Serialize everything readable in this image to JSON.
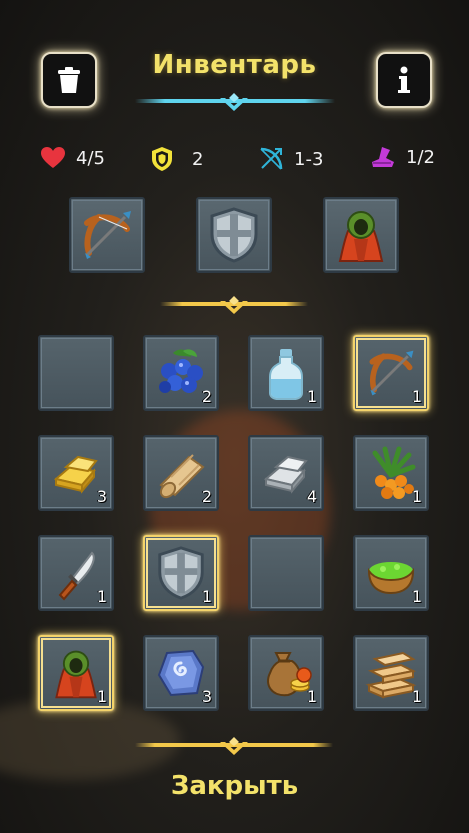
{
  "header": {
    "title": "Инвентарь",
    "trash_icon": "trash-icon",
    "info_icon": "info-icon"
  },
  "stats": [
    {
      "icon": "heart-icon",
      "value": "4/5",
      "color": "#e8343e"
    },
    {
      "icon": "shield-icon",
      "value": "2",
      "color": "#f2e23a"
    },
    {
      "icon": "bow-range-icon",
      "value": "1-3",
      "color": "#2fb4d8"
    },
    {
      "icon": "boot-icon",
      "value": "1/2",
      "color": "#c23ad8"
    }
  ],
  "equipped": [
    {
      "slot": "weapon",
      "icon": "crossbow-icon"
    },
    {
      "slot": "armor",
      "icon": "shield-icon"
    },
    {
      "slot": "cloak",
      "icon": "cloak-icon"
    }
  ],
  "inventory": [
    {
      "icon": "",
      "count": ""
    },
    {
      "icon": "blueberries-icon",
      "count": "2"
    },
    {
      "icon": "potion-bottle-icon",
      "count": "1"
    },
    {
      "icon": "crossbow-icon",
      "count": "1",
      "selected": true
    },
    {
      "icon": "gold-bars-icon",
      "count": "3"
    },
    {
      "icon": "cloth-roll-icon",
      "count": "2"
    },
    {
      "icon": "iron-bars-icon",
      "count": "4"
    },
    {
      "icon": "sea-buckthorn-icon",
      "count": "1"
    },
    {
      "icon": "knife-icon",
      "count": "1"
    },
    {
      "icon": "shield-icon",
      "count": "1",
      "selected": true
    },
    {
      "icon": "",
      "count": ""
    },
    {
      "icon": "herb-bowl-icon",
      "count": "1"
    },
    {
      "icon": "cloak-icon",
      "count": "1",
      "selected": true
    },
    {
      "icon": "rune-stone-icon",
      "count": "3"
    },
    {
      "icon": "coin-bag-icon",
      "count": "1"
    },
    {
      "icon": "wooden-planks-icon",
      "count": "1"
    }
  ],
  "footer": {
    "close_label": "Закрыть"
  },
  "colors": {
    "accent_gold": "#f3e26a",
    "accent_cyan": "#5fd4ee",
    "slot_bg": "#4e5b63"
  }
}
